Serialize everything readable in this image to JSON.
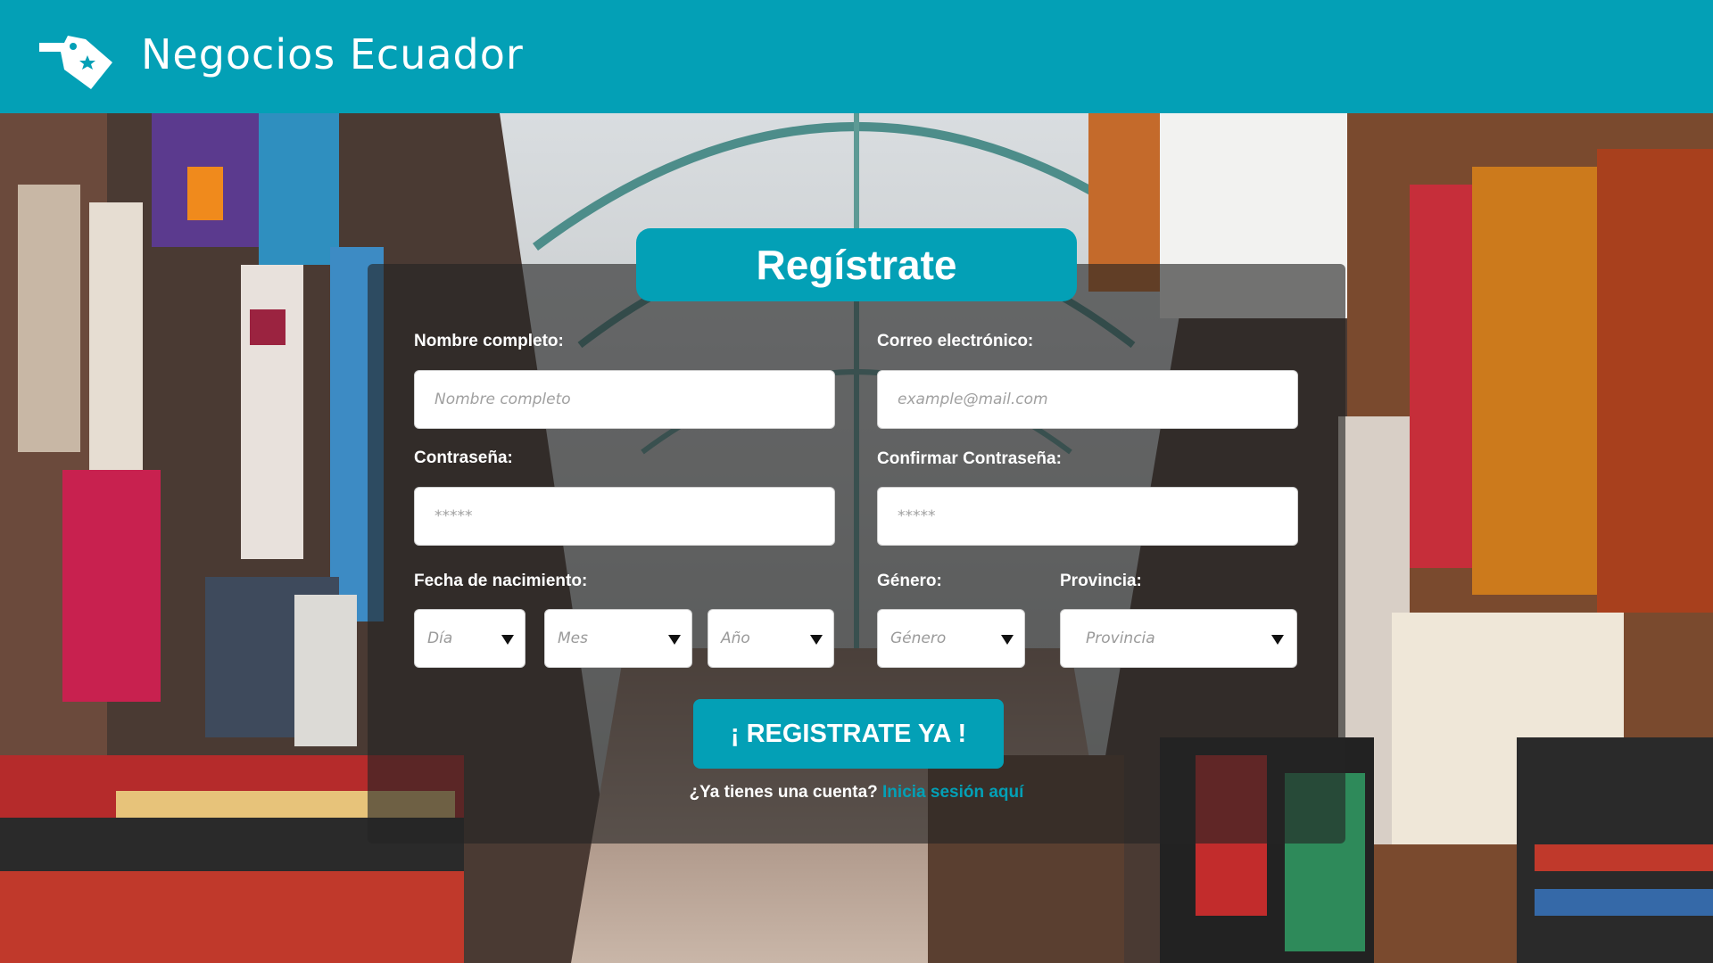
{
  "header": {
    "brand": "Negocios Ecuador",
    "logo_icon": "price-tag-star-icon",
    "background_color": "#03a0b6"
  },
  "form": {
    "title": "Regístrate",
    "fields": {
      "name_label": "Nombre completo:",
      "name_placeholder": "Nombre completo",
      "email_label": "Correo electrónico:",
      "email_placeholder": "example@mail.com",
      "password_label": "Contraseña:",
      "password_placeholder": "*****",
      "confirm_label": "Confirmar Contraseña:",
      "confirm_placeholder": "*****",
      "birth_label": "Fecha de nacimiento:",
      "day_value": "Día",
      "month_value": "Mes",
      "year_value": "Año",
      "gender_label": "Género:",
      "gender_value": "Género",
      "province_label": "Provincia:",
      "province_value": "Provincia"
    },
    "submit_label": "¡ REGISTRATE YA !",
    "login_prompt": "¿Ya tienes una cuenta?",
    "login_link": "Inicia sesión aquí"
  },
  "colors": {
    "accent": "#03a0b6",
    "panel_overlay": "rgba(35,35,35,0.62)"
  }
}
